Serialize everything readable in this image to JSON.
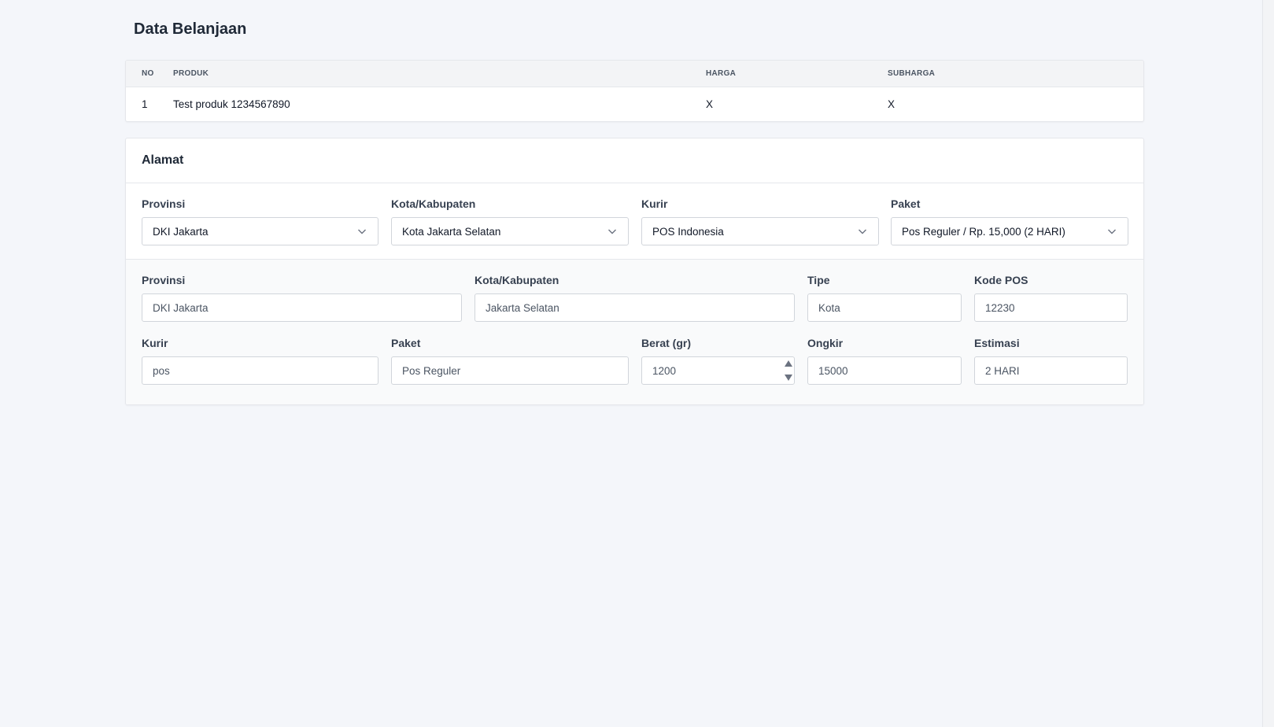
{
  "page": {
    "title": "Data Belanjaan"
  },
  "table": {
    "headers": {
      "no": "NO",
      "produk": "PRODUK",
      "harga": "HARGA",
      "subharga": "SUBHARGA"
    },
    "rows": [
      {
        "no": "1",
        "produk": "Test produk 1234567890",
        "harga": "X",
        "subharga": "X"
      }
    ]
  },
  "alamat": {
    "title": "Alamat",
    "selects": {
      "provinsi": {
        "label": "Provinsi",
        "value": "DKI Jakarta"
      },
      "kota": {
        "label": "Kota/Kabupaten",
        "value": "Kota Jakarta Selatan"
      },
      "kurir": {
        "label": "Kurir",
        "value": "POS Indonesia"
      },
      "paket": {
        "label": "Paket",
        "value": "Pos Reguler / Rp. 15,000 (2 HARI)"
      }
    },
    "info": {
      "provinsi": {
        "label": "Provinsi",
        "value": "DKI Jakarta"
      },
      "kota": {
        "label": "Kota/Kabupaten",
        "value": "Jakarta Selatan"
      },
      "tipe": {
        "label": "Tipe",
        "value": "Kota"
      },
      "kodepos": {
        "label": "Kode POS",
        "value": "12230"
      },
      "kurir": {
        "label": "Kurir",
        "value": "pos"
      },
      "paket": {
        "label": "Paket",
        "value": "Pos Reguler"
      },
      "berat": {
        "label": "Berat (gr)",
        "value": "1200"
      },
      "ongkir": {
        "label": "Ongkir",
        "value": "15000"
      },
      "estimasi": {
        "label": "Estimasi",
        "value": "2 HARI"
      }
    }
  },
  "icons": {
    "select_arrow": "chevron-down-icon",
    "stepper": "number-stepper-icon"
  }
}
